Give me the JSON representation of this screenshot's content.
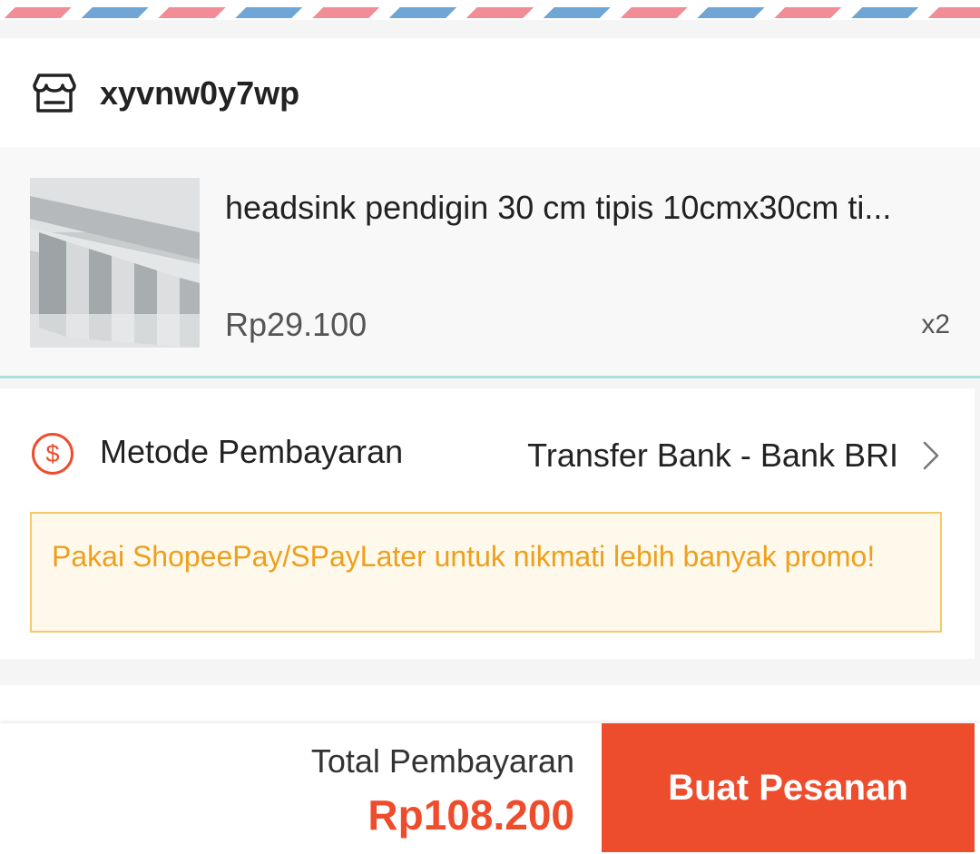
{
  "shop": {
    "name": "xyvnw0y7wp",
    "icon": "store-icon"
  },
  "product": {
    "title": "headsink pendigin 30 cm tipis 10cmx30cm ti...",
    "price": "Rp29.100",
    "quantity": "x2",
    "image": "product-image"
  },
  "payment": {
    "icon": "dollar-circle-icon",
    "label": "Metode Pembayaran",
    "value": "Transfer Bank - Bank BRI",
    "chevron": "chevron-right-icon",
    "promo_text": "Pakai ShopeePay/SPayLater untuk nikmati lebih banyak promo!"
  },
  "footer": {
    "total_label": "Total Pembayaran",
    "total_value": "Rp108.200",
    "order_button": "Buat Pesanan"
  },
  "colors": {
    "accent": "#ee4d2d",
    "promo_text": "#ee9f1c",
    "promo_border": "#f4c96a",
    "promo_bg": "#fff9eb",
    "stripe_blue": "#6fa6d6",
    "stripe_pink": "#f28c96"
  }
}
